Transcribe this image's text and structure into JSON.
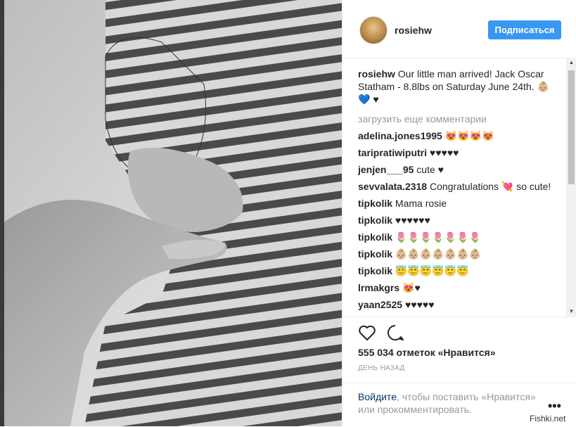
{
  "post": {
    "username": "rosiehw",
    "follow_label": "Подписаться",
    "caption_user": "rosiehw",
    "caption_text": "Our little man arrived! Jack Oscar Statham - 8.8lbs on Saturday June 24th. 👶🏼💙 ♥",
    "load_more": "загрузить еще комментарии",
    "comments": [
      {
        "user": "adelina.jones1995",
        "text": "😻😻😻😻"
      },
      {
        "user": "taripratiwiputri",
        "text": "♥♥♥♥♥"
      },
      {
        "user": "jenjen___95",
        "text": "cute ♥"
      },
      {
        "user": "sevvalata.2318",
        "text": "Congratulations 💘 so cute!"
      },
      {
        "user": "tipkolik",
        "text": "Mama rosie"
      },
      {
        "user": "tipkolik",
        "text": "♥♥♥♥♥♥"
      },
      {
        "user": "tipkolik",
        "text": "🌷🌷🌷🌷🌷🌷🌷"
      },
      {
        "user": "tipkolik",
        "text": "👶🏼👶🏼👶🏼👶🏼👶🏼👶🏼👶🏼"
      },
      {
        "user": "tipkolik",
        "text": "😇😇😇😇😇😇"
      },
      {
        "user": "lrmakgrs",
        "text": "😻♥"
      },
      {
        "user": "yaan2525",
        "text": "♥♥♥♥♥"
      }
    ],
    "likes": "555 034 отметок «Нравится»",
    "time": "ДЕНЬ НАЗАД",
    "login_link": "Войдите",
    "login_rest": ", чтобы поставить «Нравится» или прокомментировать.",
    "more_label": "•••"
  },
  "icons": {
    "like": "heart-outline-icon",
    "comment": "speech-bubble-icon",
    "scroll_up": "arrow-up-icon",
    "scroll_down": "arrow-down-icon"
  },
  "scroll": {
    "up": "▲",
    "down": "▼"
  },
  "watermark": "Fishki.net"
}
